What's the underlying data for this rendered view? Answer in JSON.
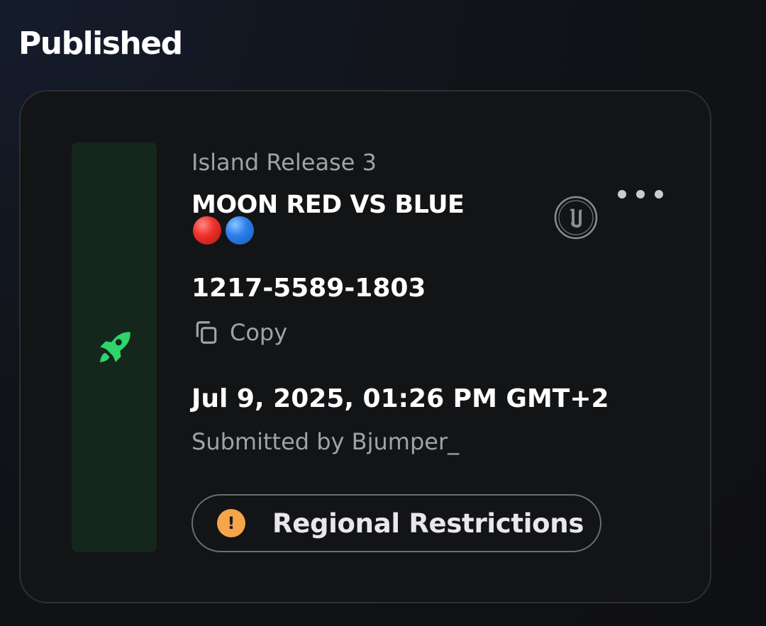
{
  "section": {
    "title": "Published"
  },
  "release": {
    "label": "Island Release 3",
    "title": "MOON RED VS BLUE",
    "emojis": [
      "red-circle",
      "blue-circle"
    ],
    "code": "1217-5589-1803",
    "copy_label": "Copy",
    "date": "Jul 9, 2025, 01:26 PM GMT+2",
    "submitted": "Submitted by Bjumper_",
    "restrictions_label": "Regional Restrictions",
    "warning_glyph": "!"
  },
  "colors": {
    "accent_green": "#2fd46b",
    "thumb_bg": "#15261d",
    "warning": "#f6a54a"
  },
  "icons": {
    "thumbnail": "rocket-icon",
    "copy": "copy-icon",
    "engine": "unreal-engine-icon",
    "menu": "more-horizontal-icon",
    "warning": "warning-icon"
  }
}
